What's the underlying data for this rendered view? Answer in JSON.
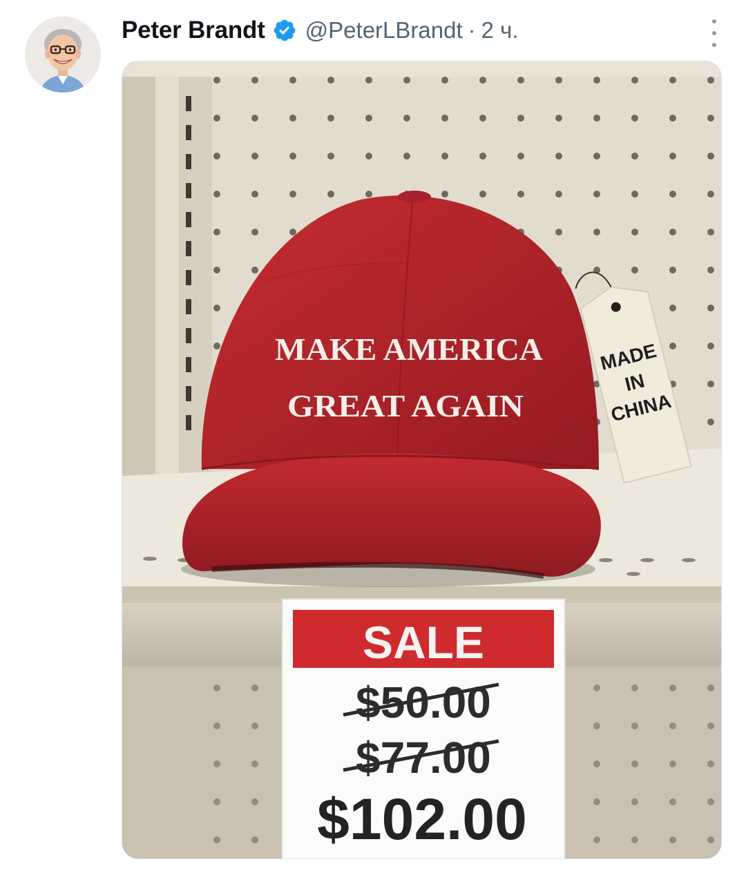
{
  "tweet": {
    "author": {
      "display_name": "Peter Brandt",
      "handle": "@PeterLBrandt",
      "verified": true,
      "avatar_icon": "avatar-caricature"
    },
    "separator": "·",
    "timestamp": "2 ч.",
    "more_icon": "more-vertical-icon",
    "colors": {
      "name": "#0f1419",
      "secondary": "#536471",
      "verified_badge": "#1d9bf0"
    },
    "image": {
      "cap_text": [
        "MAKE AMERICA",
        "GREAT AGAIN"
      ],
      "tag_text": [
        "MADE",
        "IN",
        "CHINA"
      ],
      "sign": {
        "header": "SALE",
        "prices_struck": [
          "$50.00",
          "$77.00"
        ],
        "price_current": "$102.00"
      },
      "colors": {
        "cap_red": "#b8242a",
        "sale_red": "#cf2a2e",
        "shelf": "#e8e2d3"
      }
    }
  }
}
